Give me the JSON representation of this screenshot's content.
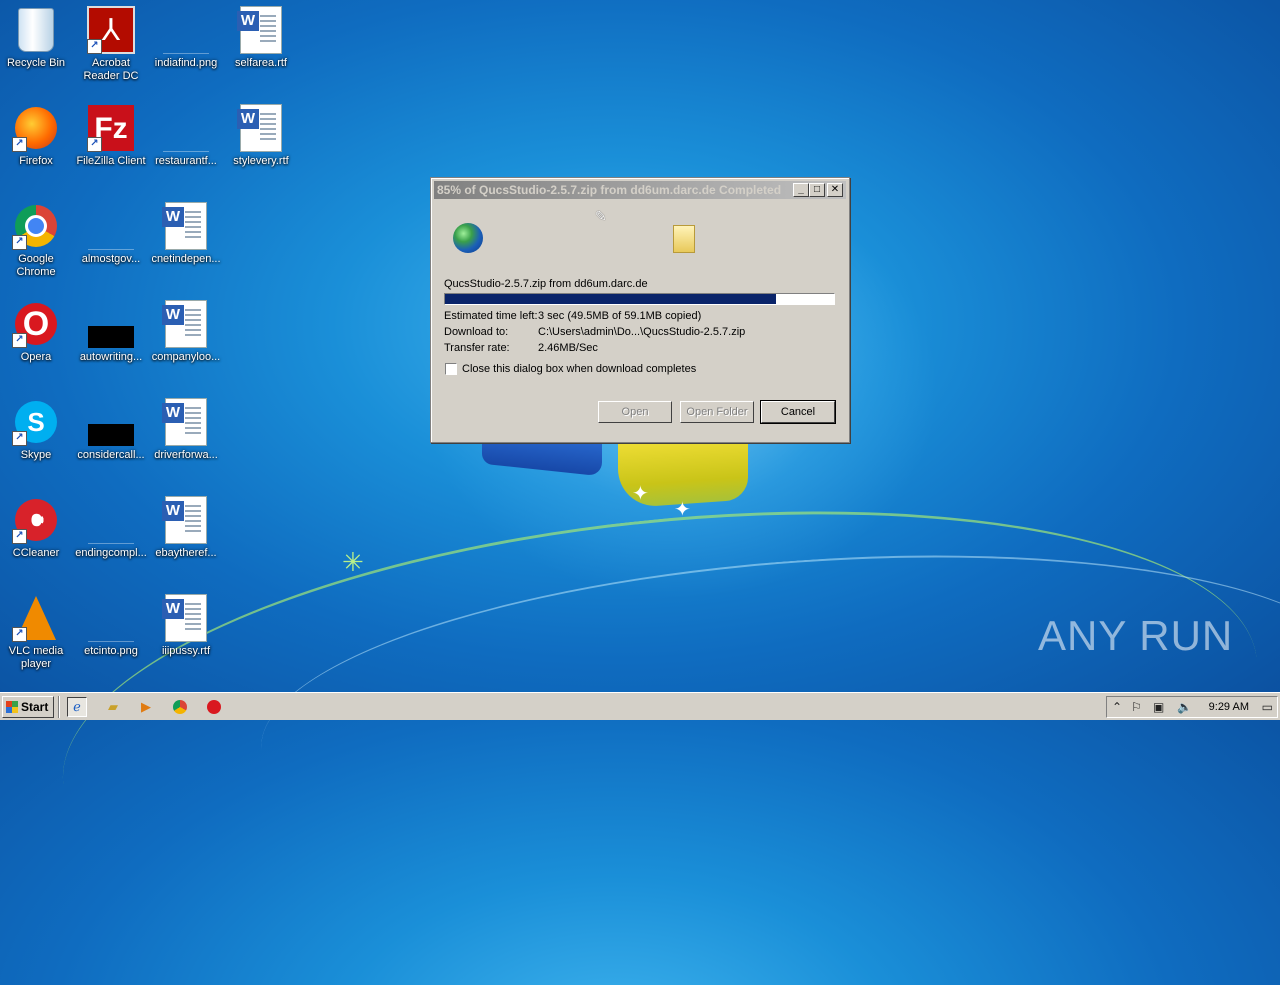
{
  "desktop": {
    "icons": [
      {
        "label": "Recycle Bin",
        "icon": "recycle-bin-icon"
      },
      {
        "label": "Acrobat\nReader DC",
        "icon": "acrobat-icon"
      },
      {
        "label": "indiafind.png",
        "icon": "image-file-icon"
      },
      {
        "label": "selfarea.rtf",
        "icon": "word-doc-icon"
      },
      {
        "label": "Firefox",
        "icon": "firefox-icon"
      },
      {
        "label": "FileZilla Client",
        "icon": "filezilla-icon"
      },
      {
        "label": "restaurantf...",
        "icon": "image-file-icon"
      },
      {
        "label": "stylevery.rtf",
        "icon": "word-doc-icon"
      },
      {
        "label": "Google\nChrome",
        "icon": "chrome-icon"
      },
      {
        "label": "almostgov...",
        "icon": "image-file-icon"
      },
      {
        "label": "cnetindepen...",
        "icon": "word-doc-icon"
      },
      {
        "label": "Opera",
        "icon": "opera-icon"
      },
      {
        "label": "autowriting...",
        "icon": "image-file-icon"
      },
      {
        "label": "companyloo...",
        "icon": "word-doc-icon"
      },
      {
        "label": "Skype",
        "icon": "skype-icon"
      },
      {
        "label": "considercall...",
        "icon": "image-file-icon"
      },
      {
        "label": "driverforwa...",
        "icon": "word-doc-icon"
      },
      {
        "label": "CCleaner",
        "icon": "ccleaner-icon"
      },
      {
        "label": "endingcompl...",
        "icon": "image-file-icon"
      },
      {
        "label": "ebaytheref...",
        "icon": "word-doc-icon"
      },
      {
        "label": "VLC media\nplayer",
        "icon": "vlc-icon"
      },
      {
        "label": "etcinto.png",
        "icon": "image-file-icon"
      },
      {
        "label": "iiipussy.rtf",
        "icon": "word-doc-icon"
      }
    ]
  },
  "dialog": {
    "title": "85% of QucsStudio-2.5.7.zip from dd6um.darc.de Completed",
    "file_line": "QucsStudio-2.5.7.zip from dd6um.darc.de",
    "progress_fraction": 0.85,
    "rows": [
      {
        "label": "Estimated time left:",
        "value": "3 sec (49.5MB of 59.1MB copied)"
      },
      {
        "label": "Download to:",
        "value": "C:\\Users\\admin\\Do...\\QucsStudio-2.5.7.zip"
      },
      {
        "label": "Transfer rate:",
        "value": "2.46MB/Sec"
      }
    ],
    "checkbox_label": "Close this dialog box when download completes",
    "checkbox_checked": false,
    "buttons": {
      "open": "Open",
      "open_folder": "Open Folder",
      "cancel": "Cancel"
    },
    "title_buttons": {
      "minimize": "_",
      "maximize": "□",
      "close": "✕"
    }
  },
  "taskbar": {
    "start_label": "Start",
    "clock": "9:29 AM"
  },
  "watermark": "ANY RUN",
  "colors": {
    "progress_fill": "#0a246a",
    "desktop_bg": "#1a8fd8",
    "chrome_face": "#d4d0c8"
  }
}
